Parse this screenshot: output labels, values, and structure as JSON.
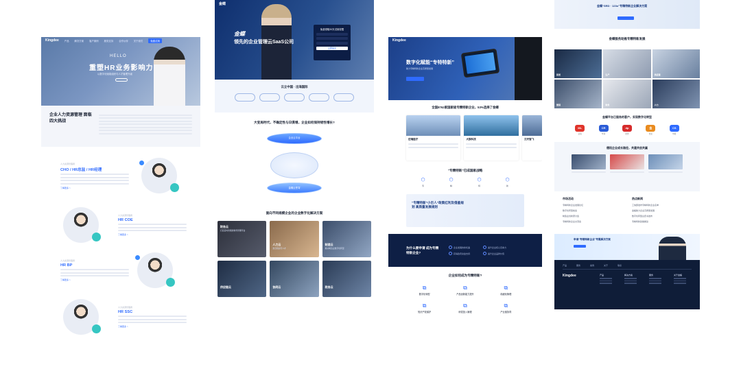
{
  "page1": {
    "nav": {
      "logo": "Kingdee",
      "links": [
        "产品",
        "解决方案",
        "客户案例",
        "服务支持",
        "合作伙伴",
        "关于我们"
      ],
      "cta": "免费试用"
    },
    "hero": {
      "hello": "HELLO",
      "title": "重塑HR业务影响力",
      "subtitle": "以数字化赋能组织与人才管理升级"
    },
    "challenge": {
      "title": "企业人力资源管理 面临四大挑战"
    },
    "roles": [
      {
        "kicker": "人力资源管理者",
        "name": "CHO / HR总监 / HR经理",
        "more": "了解更多 >"
      },
      {
        "kicker": "人力资源管理者",
        "name": "HR COE",
        "more": "了解更多 >"
      },
      {
        "kicker": "人力资源管理者",
        "name": "HR BP",
        "more": "了解更多 >"
      },
      {
        "kicker": "人力资源管理者",
        "name": "HR SSC",
        "more": "了解更多 >"
      }
    ]
  },
  "page2": {
    "nav": {
      "logo": "金蝶"
    },
    "hero": {
      "brand": "金蝶",
      "title": "领先的企业管理云SaaS公司"
    },
    "form": {
      "title": "免费领取30天试用权限",
      "submit": "立即提交"
    },
    "badges": {
      "title": "云立中国 · 出海国际",
      "items": [
        "",
        "",
        "",
        "",
        ""
      ]
    },
    "question": {
      "title": "大变局时代，不确定性与日俱增，企业如何保持韧性增长?"
    },
    "diagram": {
      "top": "企业云平台",
      "bottom": "金蝶云苍穹"
    },
    "solutions": {
      "title": "面向不同规模企业的企业数字化解决方案"
    },
    "cards": [
      {
        "label": "财务云",
        "sub": "打造实时智能的财务管理平台"
      },
      {
        "label": "人力云",
        "sub": "激活组织与人才"
      },
      {
        "label": "制造云",
        "sub": "推动制造业数字化转型"
      },
      {
        "label": "供应链云",
        "sub": ""
      },
      {
        "label": "协同云",
        "sub": ""
      },
      {
        "label": "税务云",
        "sub": ""
      }
    ]
  },
  "page3": {
    "nav": {
      "logo": "Kingdee"
    },
    "hero": {
      "title": "数字化赋能“专特特新”",
      "sub": "助力专精特新企业高质量发展"
    },
    "stat": {
      "title": "全国8762家国家级专精特新企业，53%选择了金蝶"
    },
    "cards": [
      {
        "title": "迈瑞医疗"
      },
      {
        "title": "大族科技"
      },
      {
        "title": "汉天智飞"
      }
    ],
    "policy": {
      "title": "“专精特新”已成国家战略"
    },
    "icons": [
      "专",
      "精",
      "特",
      "新"
    ],
    "banner": {
      "title": "“专精特新”小巨人”政策红利及借鉴规划 高质量发展规划"
    },
    "dark": {
      "title": "为什么要申请 成为专精特新企业?",
      "options": [
        "企业发展的新机遇",
        "提升企业核心竞争力",
        "获得政府资金支持",
        "提升企业品牌价值"
      ]
    },
    "how": {
      "title": "企业如何成为专精特新?"
    },
    "features": [
      "数字化转型",
      "产品创新能力提升",
      "精细化管理",
      "知识产权保护",
      "研发投入管理",
      "产业链协同"
    ]
  },
  "page4": {
    "top": {
      "title": "金蝶“SRD · 123o”专精特新企业解决方案"
    },
    "section": {
      "title": "金蝶服务助推专精特新发展"
    },
    "photos": [
      "研发",
      "生产",
      "供应链",
      "营销",
      "财务",
      "人力"
    ],
    "logos_title": "金蝶平台已服务的客户，实现数字化转型",
    "logos": [
      {
        "txt": "ML",
        "color": "#e0342b",
        "name": "迈瑞"
      },
      {
        "txt": "CR",
        "color": "#2a5bd7",
        "name": "华润"
      },
      {
        "txt": "dp",
        "color": "#d62b2b",
        "name": "德普"
      },
      {
        "txt": "金",
        "color": "#e98b1f",
        "name": "金龙"
      },
      {
        "txt": "CS",
        "color": "#2f6bff",
        "name": "中船"
      }
    ],
    "growth": {
      "title": "德阳企业成长路径，共建共创共赢"
    },
    "news": {
      "events_title": "市场活动",
      "hot_title": "热点新闻"
    },
    "events": [
      "专精特新企业发展论坛",
      "数字化转型峰会",
      "制造业创新研讨会",
      "专精特新企业交流会"
    ],
    "hot": [
      "工信部发布专精特新企业名单",
      "金蝶助力企业高质量发展",
      "数字化转型白皮书发布",
      "专精特新政策解读"
    ],
    "cta": {
      "title": "申请“专精特新企业”专属解决方案"
    },
    "footer": {
      "brand": "Kingdee",
      "tabs": [
        "产品",
        "服务",
        "案例",
        "关于",
        "联系"
      ],
      "cols": [
        "产品",
        "解决方案",
        "服务",
        "关于金蝶"
      ]
    }
  }
}
